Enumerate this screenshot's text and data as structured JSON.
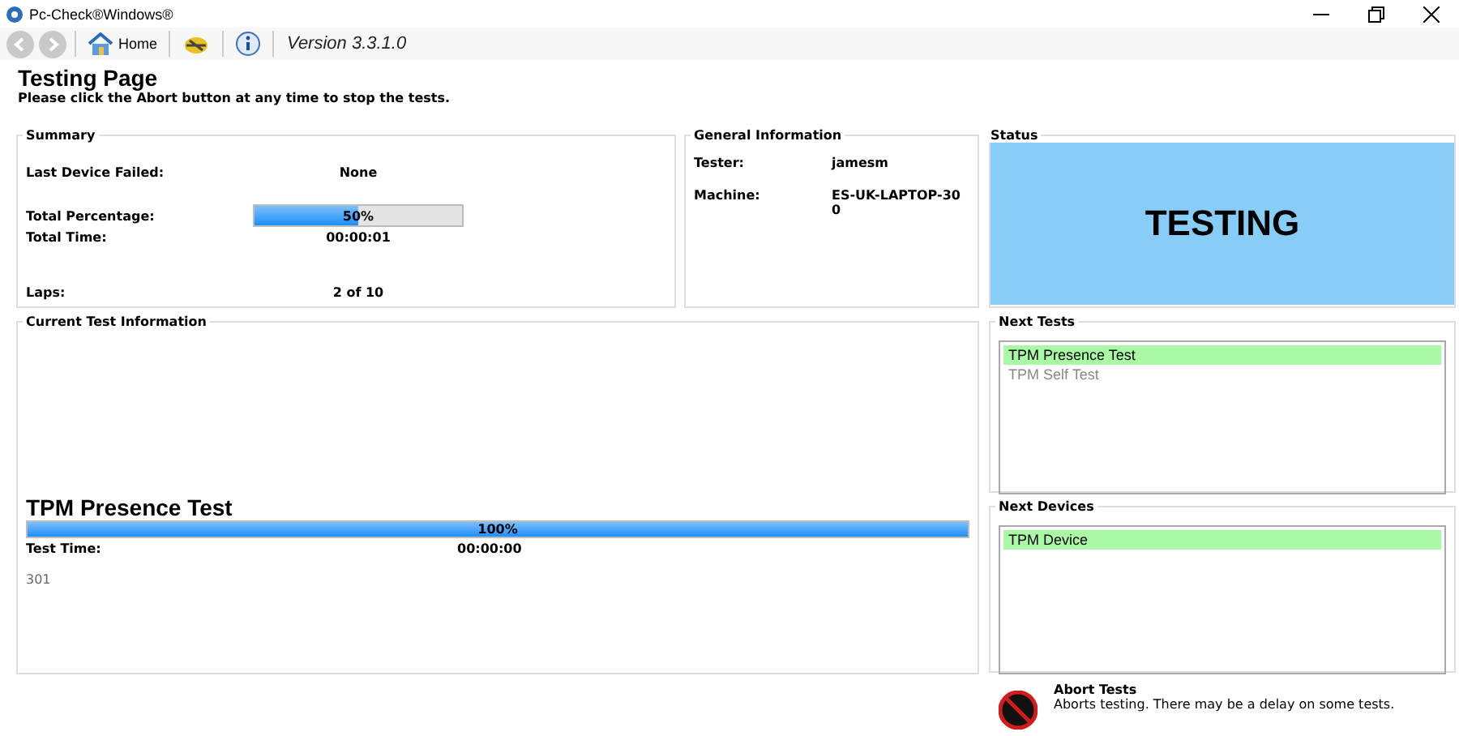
{
  "window": {
    "title": "Pc-Check®Windows®"
  },
  "toolbar": {
    "back": {
      "disabled": true
    },
    "forward": {
      "disabled": true
    },
    "home": "Home",
    "version": "Version 3.3.1.0"
  },
  "heading": "Testing Page",
  "instruction": "Please click the Abort button at any time to stop the tests.",
  "summary": {
    "title": "Summary",
    "last_failed_label": "Last Device Failed:",
    "last_failed": "None",
    "percentage_label": "Total Percentage:",
    "percentage": {
      "level": 0.5,
      "reading": "50%"
    },
    "time_label": "Total Time:",
    "time": "00:00:01",
    "laps_label": "Laps:",
    "laps": "2 of 10"
  },
  "general": {
    "title": "General Information",
    "rows": [
      {
        "label": "Tester:",
        "value": "jamesm"
      },
      {
        "label": "Machine:",
        "value": "ES-UK-LAPTOP-30\n0"
      }
    ]
  },
  "status": {
    "title": "Status",
    "text": "TESTING"
  },
  "current": {
    "title": "Current Test Information",
    "test_name": "TPM Presence Test",
    "progress": {
      "level": 1,
      "reading": "100%"
    },
    "time_label": "Test Time:",
    "time": "00:00:00",
    "code": "301"
  },
  "next_tests": {
    "title": "Next Tests",
    "items": [
      {
        "label": "TPM Presence Test",
        "selected": true
      },
      {
        "label": "TPM Self Test",
        "selected": false
      }
    ]
  },
  "next_devices": {
    "title": "Next Devices",
    "items": [
      {
        "label": "TPM Device",
        "selected": true
      }
    ]
  },
  "abort": {
    "title": "Abort Tests",
    "description": "Aborts testing. There may be a delay on some tests."
  }
}
